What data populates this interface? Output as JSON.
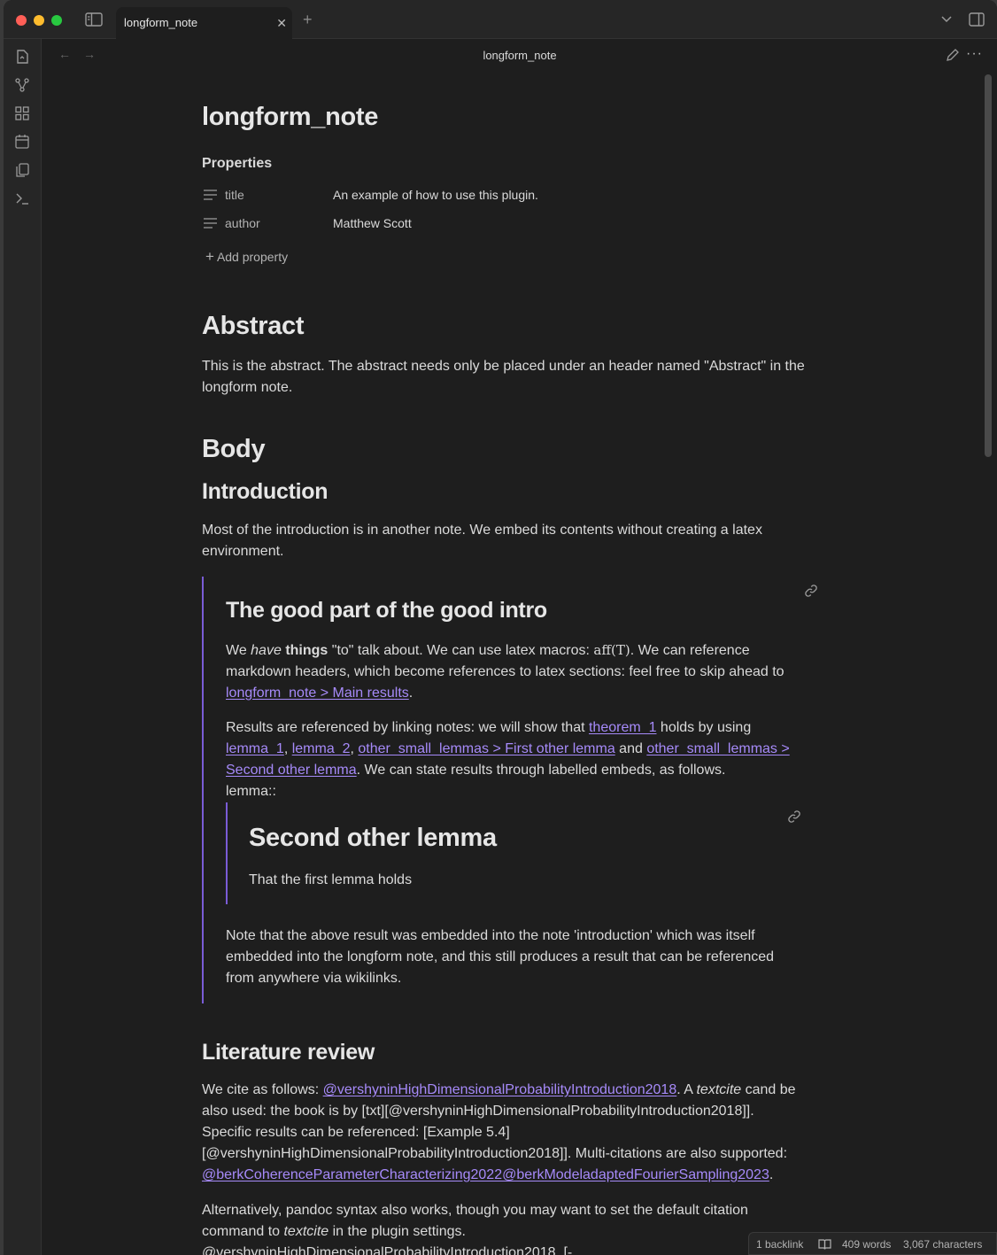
{
  "tab": {
    "label": "longform_note",
    "close": "✕",
    "new": "+"
  },
  "view": {
    "title": "longform_note",
    "back": "←",
    "forward": "→",
    "more": "···"
  },
  "document": {
    "title": "longform_note",
    "properties_heading": "Properties",
    "properties": [
      {
        "key": "title",
        "value": "An example of how to use this plugin."
      },
      {
        "key": "author",
        "value": "Matthew Scott"
      }
    ],
    "add_property": "Add property",
    "abstract": {
      "heading": "Abstract",
      "line1": "This is the abstract. The abstract needs only be placed under an header named \"Abstract\" in the",
      "line2": "longform note."
    },
    "body": {
      "heading": "Body",
      "intro_heading": "Introduction",
      "intro_line1": "Most of the introduction is in another note. We embed its contents without creating a latex",
      "intro_line2": "environment."
    },
    "embed": {
      "heading": "The good part of the good intro",
      "p1": {
        "we": "We ",
        "have": "have",
        "sp1": " ",
        "things": "things",
        "rest1": " \"to\" talk about. We can use latex macros: ",
        "math": "aff(T)",
        "rest2": ". We can reference",
        "line2": "markdown headers, which become references to latex sections: feel free to skip ahead to",
        "link": "longform_note > Main results",
        "dot": "."
      },
      "p2": {
        "text1": "Results are referenced by linking notes: we will show that ",
        "link_theorem": "theorem_1",
        "text2": " holds by using",
        "link_lemma1": "lemma_1",
        "comma1": ", ",
        "link_lemma2": "lemma_2",
        "comma2": ", ",
        "link_first_other": "other_small_lemmas > First other lemma",
        "and": " and ",
        "link_second_a": "other_small_lemmas >",
        "link_second_b": "Second other lemma",
        "text3": ". We can state results through labelled embeds, as follows.",
        "label": "lemma::"
      },
      "inner": {
        "heading": "Second other lemma",
        "text": "That the first lemma holds"
      },
      "p3": {
        "line1": "Note that the above result was embedded into the note 'introduction' which was itself",
        "line2": "embedded into the longform note, and this still produces a result that can be referenced",
        "line3": "from anywhere via wikilinks."
      }
    },
    "literature": {
      "heading": "Literature review",
      "p1": {
        "text1": "We cite as follows: ",
        "cite1": "@vershyninHighDimensionalProbabilityIntroduction2018",
        "text2": ". A ",
        "textcite": "textcite",
        "text3": " cand be",
        "line2": "also used: the book is by [txt][@vershyninHighDimensionalProbabilityIntroduction2018]].",
        "line3": "Specific results can be referenced: [Example 5.4]",
        "line4": "[@vershyninHighDimensionalProbabilityIntroduction2018]]. Multi-citations are also supported:",
        "cite_multi": "@berkCoherenceParameterCharacterizing2022@berkModeladaptedFourierSampling2023",
        "dot": "."
      },
      "p2": {
        "line1": "Alternatively, pandoc syntax also works, though you may want to set the default citation",
        "line2a": "command to ",
        "line2_italic": "textcite",
        "line2b": " in the plugin settings.",
        "line3": "@vershyninHighDimensionalProbabilityIntroduction2018, [-"
      }
    }
  },
  "status": {
    "backlinks": "1 backlink",
    "words": "409 words",
    "characters": "3,067 characters"
  },
  "colors": {
    "accent": "#a68af9",
    "embed_border": "#7a5cd6",
    "background": "#1e1e1e"
  }
}
